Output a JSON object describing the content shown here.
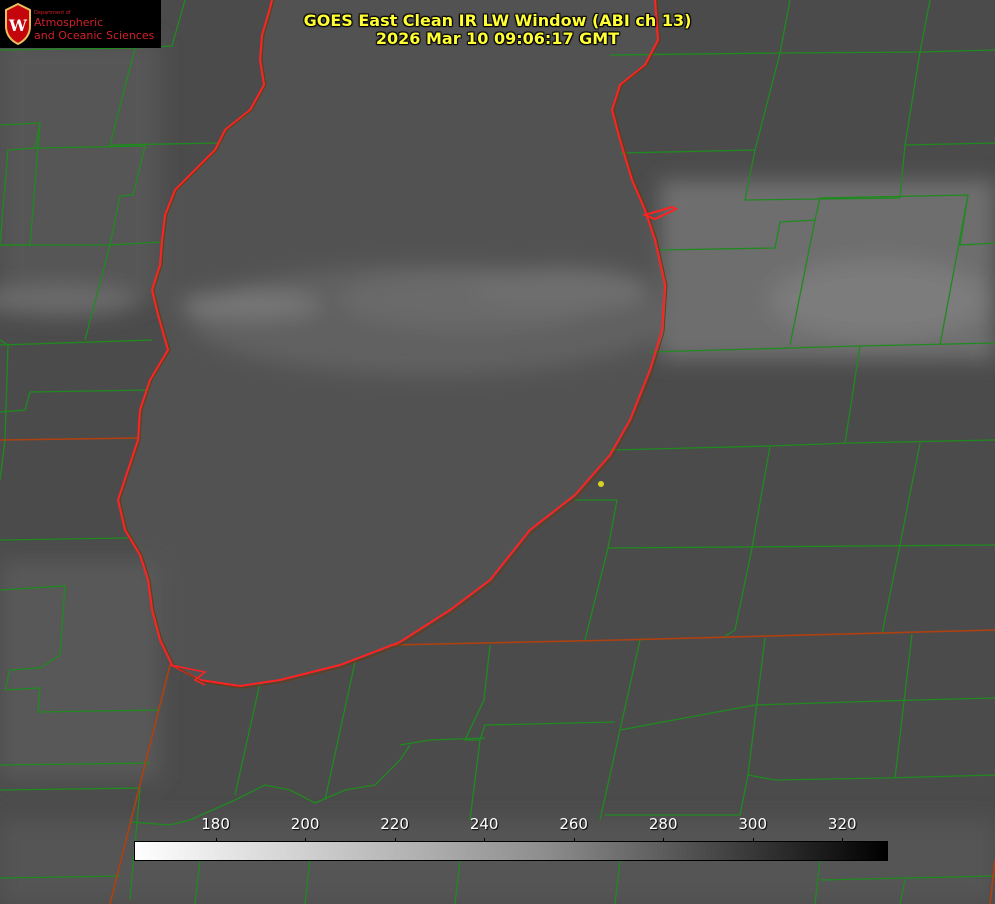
{
  "title": {
    "line1": "GOES East Clean IR LW Window (ABI ch 13)",
    "line2": "2026 Mar 10 09:06:17 GMT"
  },
  "logo": {
    "dept": "Department of",
    "line1": "Atmospheric",
    "line2": "and Oceanic Sciences",
    "emblem": "W",
    "icon": "uw-crest-icon"
  },
  "colorbar": {
    "ticks": [
      "180",
      "200",
      "220",
      "240",
      "260",
      "280",
      "300",
      "320"
    ],
    "min": 162,
    "max": 330
  },
  "colors": {
    "title": "#ffff33",
    "lake_outline": "#ff2222",
    "county_lines": "#1f8a1f",
    "state_lines": "#b04010",
    "marker": "#d4d424"
  }
}
